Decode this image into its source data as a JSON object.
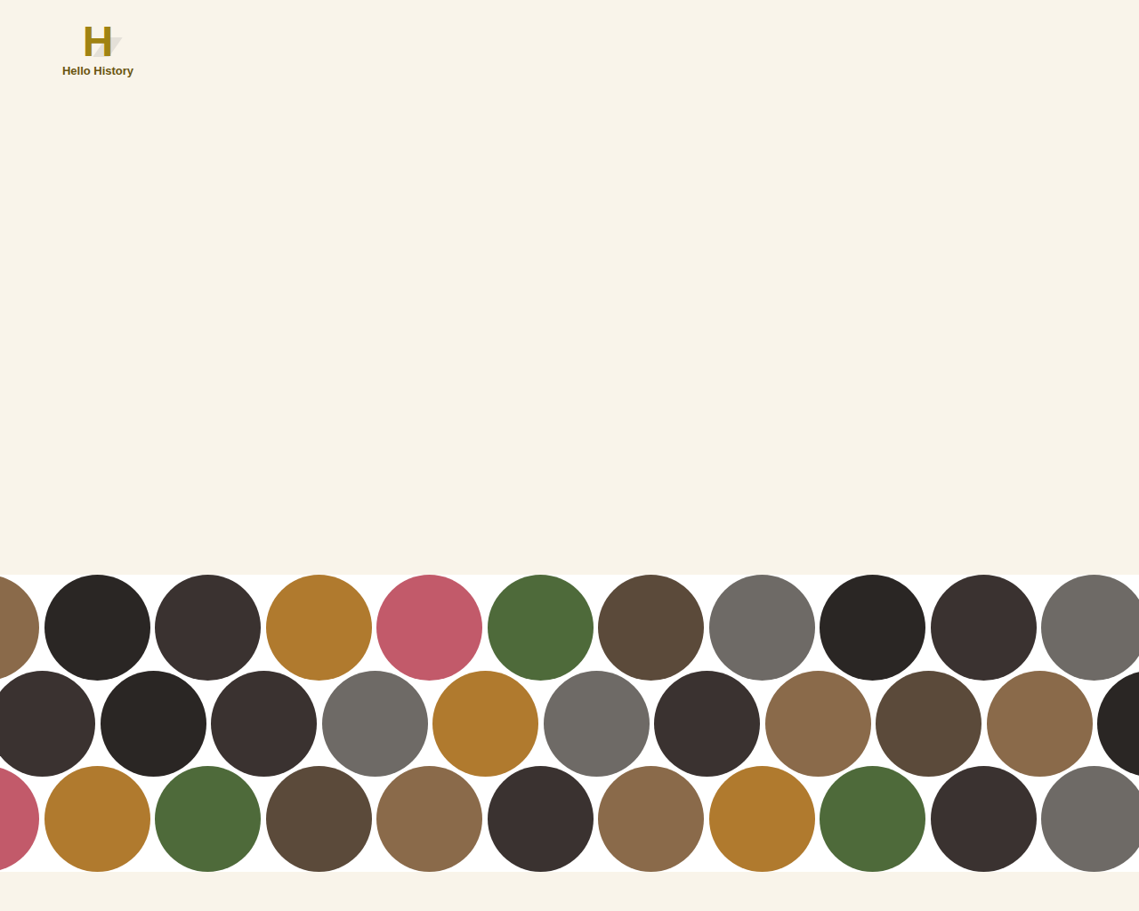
{
  "logo": {
    "mark": "H",
    "name": "Hello History"
  }
}
